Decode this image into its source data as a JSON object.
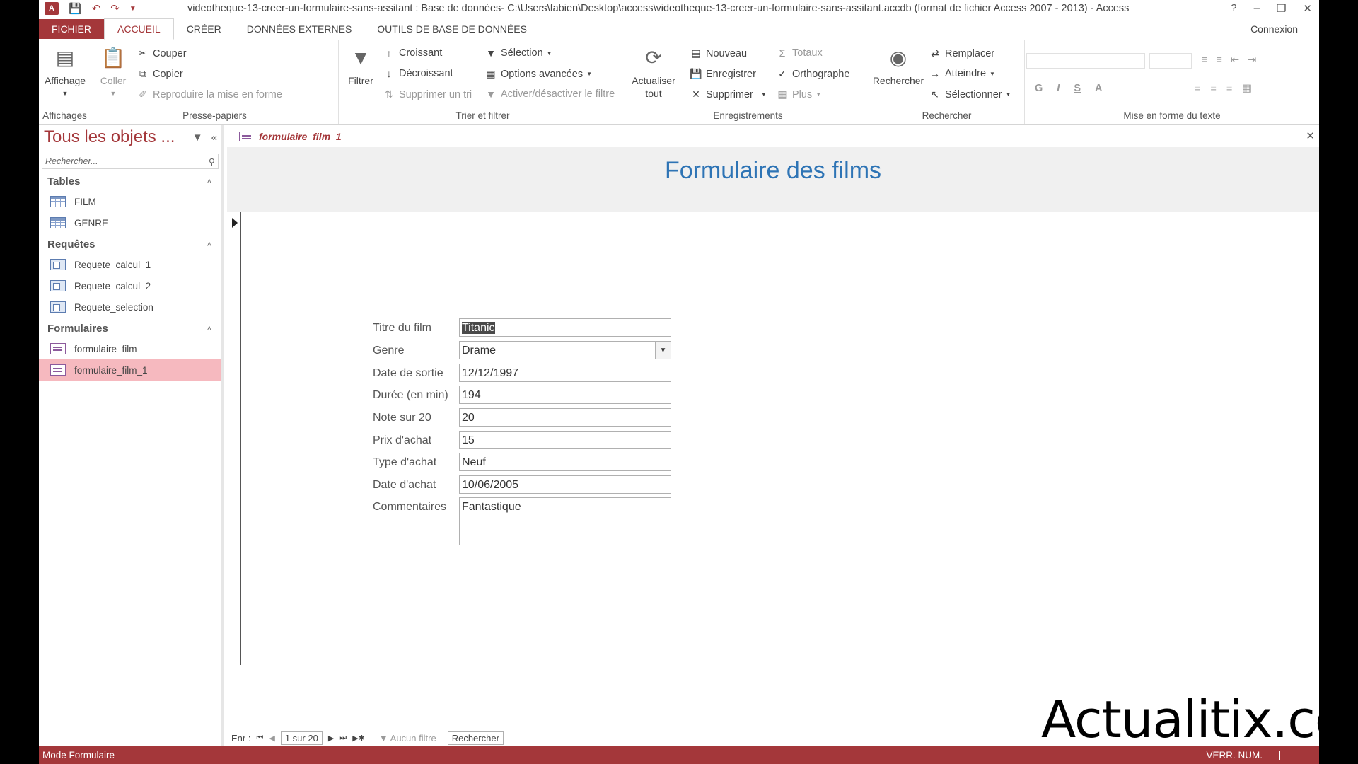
{
  "window": {
    "title": "videotheque-13-creer-un-formulaire-sans-assitant : Base de données- C:\\Users\\fabien\\Desktop\\access\\videotheque-13-creer-un-formulaire-sans-assitant.accdb (format de fichier Access 2007 - 2013) - Access",
    "app_logo": "A",
    "help": "?",
    "minimize": "–",
    "restore": "❐",
    "close": "✕"
  },
  "ribbon_tabs": [
    {
      "label": "FICHIER"
    },
    {
      "label": "ACCUEIL"
    },
    {
      "label": "CRÉER"
    },
    {
      "label": "DONNÉES EXTERNES"
    },
    {
      "label": "OUTILS DE BASE DE DONNÉES"
    }
  ],
  "connexion": "Connexion",
  "ribbon": {
    "affichages": {
      "label": "Affichages",
      "affichage": "Affichage"
    },
    "presse_papiers": {
      "label": "Presse-papiers",
      "coller": "Coller",
      "couper": "Couper",
      "copier": "Copier",
      "reproduire": "Reproduire la mise en forme"
    },
    "trier": {
      "label": "Trier et filtrer",
      "filtrer": "Filtrer",
      "croissant": "Croissant",
      "decroissant": "Décroissant",
      "supprimer_tri": "Supprimer un tri",
      "selection": "Sélection",
      "options": "Options avancées",
      "activer": "Activer/désactiver le filtre"
    },
    "enregistrements": {
      "label": "Enregistrements",
      "actualiser": "Actualiser",
      "actualiser2": "tout",
      "nouveau": "Nouveau",
      "enregistrer": "Enregistrer",
      "supprimer": "Supprimer",
      "totaux": "Totaux",
      "orthographe": "Orthographe",
      "plus": "Plus"
    },
    "rechercher": {
      "label": "Rechercher",
      "rechercher": "Rechercher",
      "remplacer": "Remplacer",
      "atteindre": "Atteindre",
      "selectionner": "Sélectionner"
    },
    "mise_en_forme": {
      "label": "Mise en forme du texte",
      "bold": "G",
      "italic": "I",
      "underline": "S",
      "fontcolor": "A"
    }
  },
  "nav": {
    "title": "Tous les objets ...",
    "search_placeholder": "Rechercher...",
    "sections": [
      {
        "label": "Tables",
        "items": [
          "FILM",
          "GENRE"
        ]
      },
      {
        "label": "Requêtes",
        "items": [
          "Requete_calcul_1",
          "Requete_calcul_2",
          "Requete_selection"
        ]
      },
      {
        "label": "Formulaires",
        "items": [
          "formulaire_film",
          "formulaire_film_1"
        ]
      }
    ]
  },
  "document": {
    "tab_label": "formulaire_film_1",
    "form_title": "Formulaire des films",
    "fields": [
      {
        "label": "Titre du film",
        "value": "Titanic"
      },
      {
        "label": "Genre",
        "value": "Drame"
      },
      {
        "label": "Date de sortie",
        "value": "12/12/1997"
      },
      {
        "label": "Durée (en min)",
        "value": "194"
      },
      {
        "label": "Note sur 20",
        "value": "20"
      },
      {
        "label": "Prix d'achat",
        "value": "15"
      },
      {
        "label": "Type d'achat",
        "value": "Neuf"
      },
      {
        "label": "Date d'achat",
        "value": "10/06/2005"
      },
      {
        "label": "Commentaires",
        "value": "Fantastique"
      }
    ],
    "record_nav": {
      "label": "Enr :",
      "position": "1 sur 20",
      "filter": "Aucun filtre",
      "search": "Rechercher"
    }
  },
  "status": {
    "mode": "Mode Formulaire",
    "indicators": "VERR. NUM."
  },
  "watermark": "Actualitix.com",
  "colors": {
    "accent": "#a4373a",
    "title_blue": "#2e74b5",
    "selected_item": "#f6b9bf"
  }
}
